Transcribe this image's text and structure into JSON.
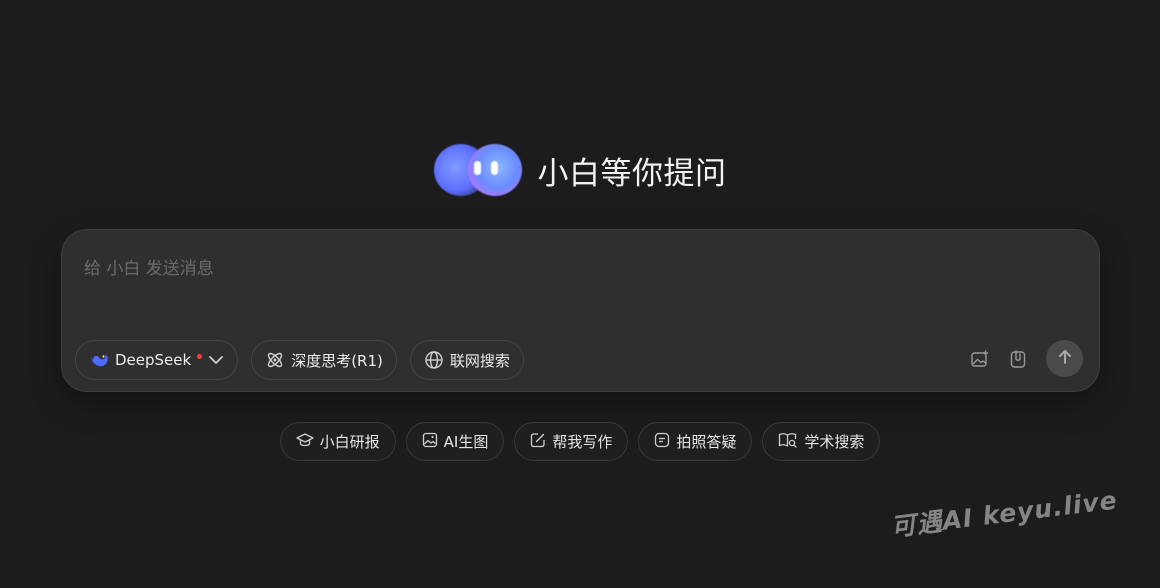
{
  "hero": {
    "title": "小白等你提问",
    "mascot_icon": "twin-blob-mascot"
  },
  "input": {
    "placeholder": "给 小白 发送消息",
    "value": ""
  },
  "toolbar": {
    "model_label": "DeepSeek",
    "model_icon": "deepseek-whale-icon",
    "deep_think_label": "深度思考(R1)",
    "web_search_label": "联网搜索",
    "image_upload_icon": "image-plus-icon",
    "attach_icon": "paperclip-icon",
    "send_icon": "arrow-up-icon"
  },
  "quick_actions": [
    {
      "label": "小白研报",
      "icon": "graduation-cap-icon"
    },
    {
      "label": "AI生图",
      "icon": "image-icon"
    },
    {
      "label": "帮我写作",
      "icon": "edit-icon"
    },
    {
      "label": "拍照答疑",
      "icon": "note-icon"
    },
    {
      "label": "学术搜索",
      "icon": "book-search-icon"
    }
  ],
  "watermark": "可遇AI  keyu.live",
  "colors": {
    "background": "#1c1c1c",
    "card": "#2f2f2f",
    "accent_blue": "#5b6dff",
    "status_dot": "#ff3b3b"
  }
}
